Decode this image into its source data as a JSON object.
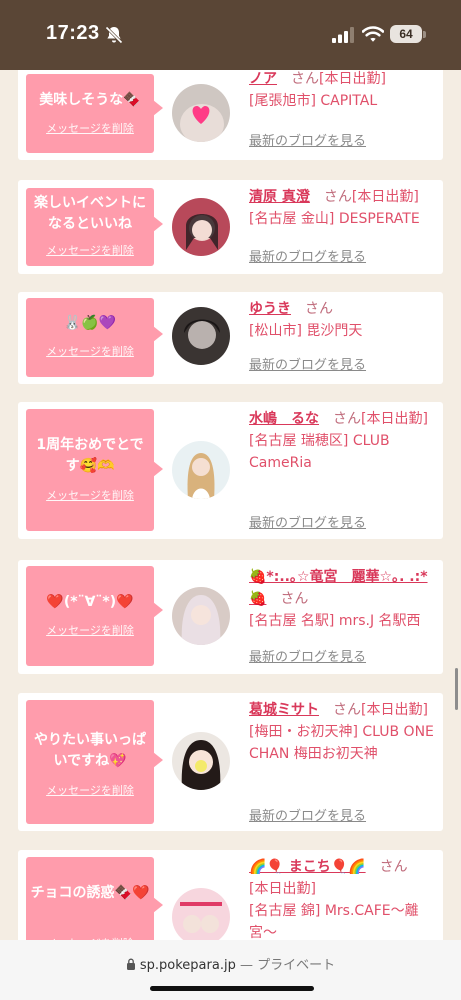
{
  "status_bar": {
    "time": "17:23",
    "battery": "64"
  },
  "blog_link_label": "最新のブログを見る",
  "delete_label": "メッセージを削除",
  "cards": [
    {
      "message": "美味しそうな🍫",
      "name": "ノア",
      "honor": "さん",
      "tag": "[本日出勤]",
      "shop": "[尾張旭市] CAPITAL"
    },
    {
      "message": "楽しいイベントになるといいね",
      "name": "清原 真澄",
      "honor": "さん",
      "tag": "[本日出勤]",
      "shop": "[名古屋 金山] DESPERATE"
    },
    {
      "message": "🐰🍏💜",
      "name": "ゆうき",
      "honor": "さん",
      "tag": "",
      "shop": "[松山市] 毘沙門天"
    },
    {
      "message": "1周年おめでとです🥰🫶",
      "name": "水嶋　るな",
      "honor": "さん",
      "tag": "[本日出勤]",
      "shop": "[名古屋 瑞穂区] CLUB CameRia"
    },
    {
      "message": "❤️(*¨∀¨*)❤️",
      "name": "🍓*:..｡☆竜宮　麗華☆｡. .:*🍓",
      "honor": "さん",
      "tag": "",
      "shop": "[名古屋 名駅] mrs.J 名駅西"
    },
    {
      "message": "やりたい事いっぱいですね💖",
      "name": "葛城ミサト",
      "honor": "さん",
      "tag": "[本日出勤]",
      "shop": "[梅田・お初天神] CLUB ONE CHAN 梅田お初天神"
    },
    {
      "message": "チョコの誘惑🍫❤️",
      "name": "🌈🎈 まこち🎈🌈",
      "honor": "さん",
      "tag": "[本日出勤]",
      "shop": "[名古屋 錦] Mrs.CAFE〜離宮〜"
    }
  ],
  "browser": {
    "domain": "sp.pokepara.jp",
    "separator": "—",
    "mode": "プライベート"
  },
  "colors": {
    "bubble": "#ff9cac",
    "name": "#d9385a",
    "status_bar": "#5a4636",
    "page_bg": "#f4ede3"
  }
}
